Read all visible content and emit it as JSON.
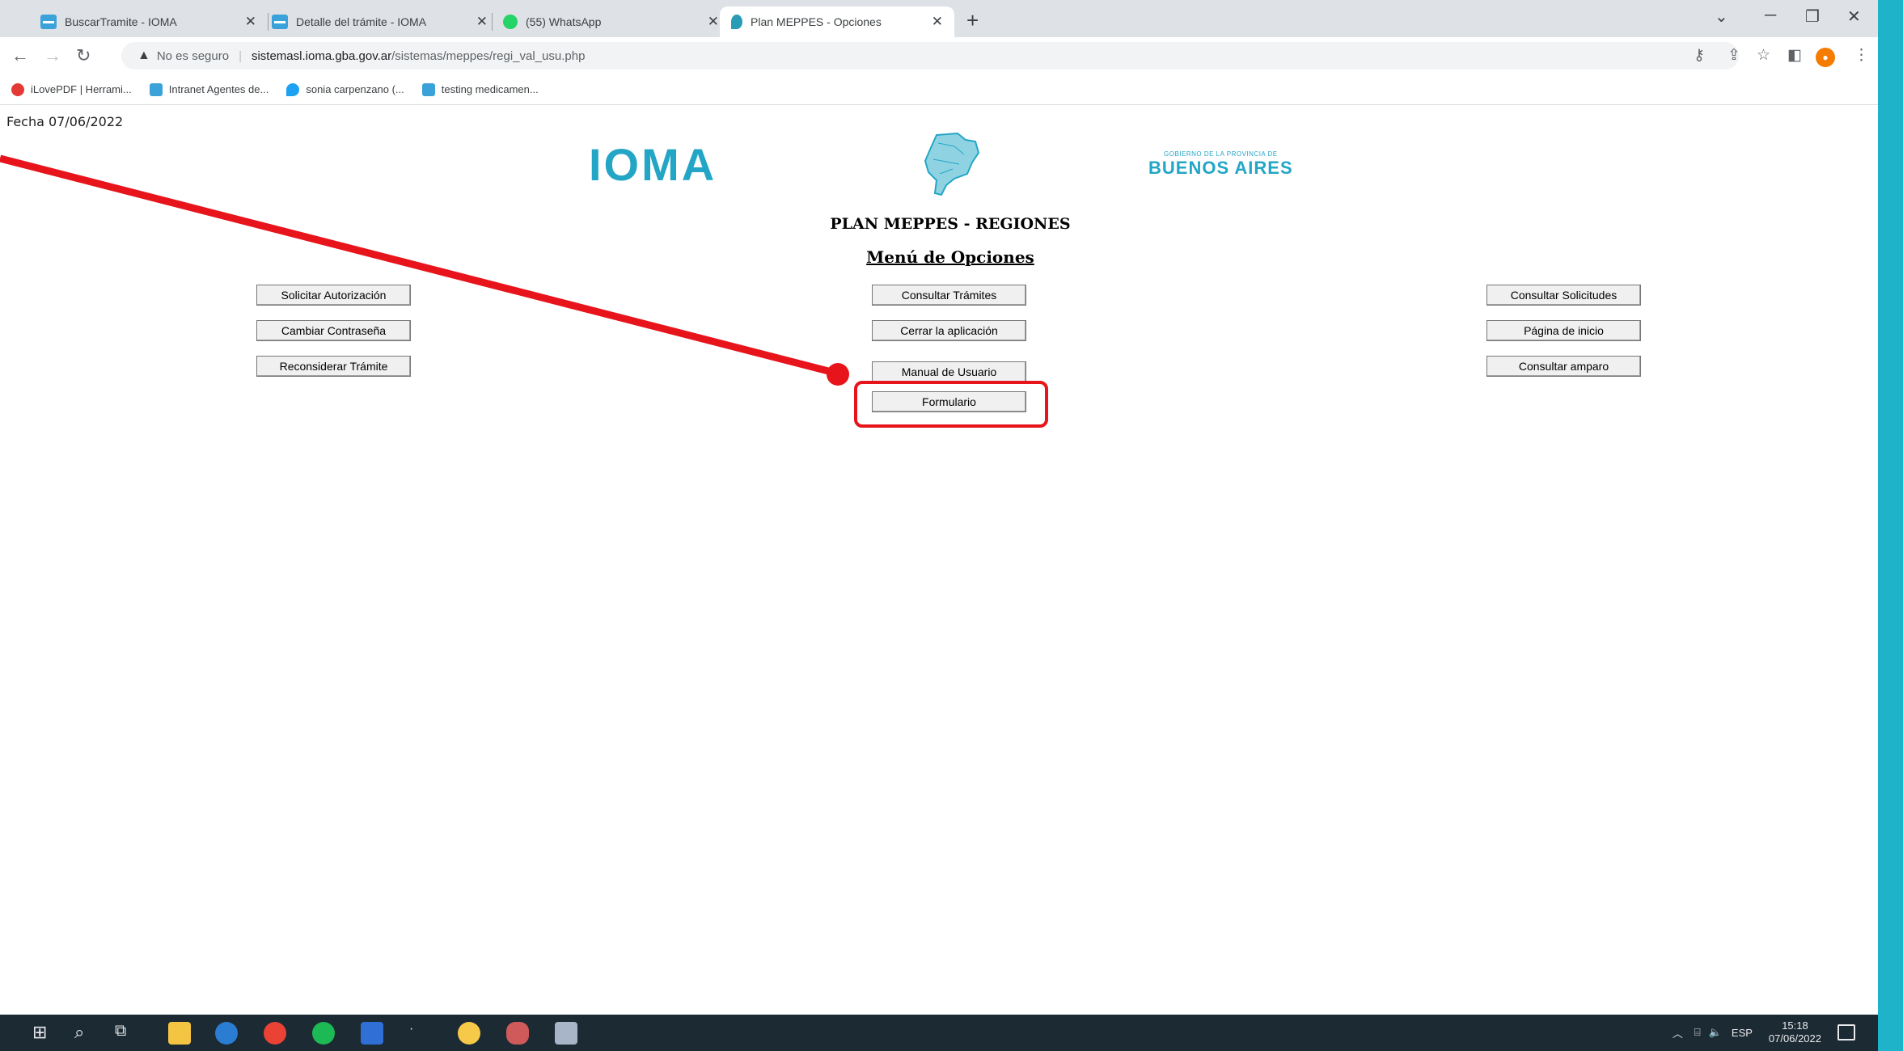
{
  "tabs": [
    {
      "title": "BuscarTramite - IOMA",
      "active": false
    },
    {
      "title": "Detalle del trámite - IOMA",
      "active": false
    },
    {
      "title": "(55) WhatsApp",
      "active": false
    },
    {
      "title": "Plan MEPPES - Opciones",
      "active": true
    }
  ],
  "address_bar": {
    "security": "No es seguro",
    "host": "sistemasl.ioma.gba.gov.ar",
    "path": "/sistemas/meppes/regi_val_usu.php"
  },
  "bookmarks": [
    {
      "label": "iLovePDF | Herrami...",
      "icon": "ilovepdf-icon"
    },
    {
      "label": "Intranet Agentes de...",
      "icon": "ioma-icon"
    },
    {
      "label": "sonia carpenzano (...",
      "icon": "twitter-icon"
    },
    {
      "label": "testing medicamen...",
      "icon": "ioma-icon"
    }
  ],
  "page": {
    "fecha": "Fecha 07/06/2022",
    "logo_text": "IOMA",
    "gob_small": "GOBIERNO DE LA PROVINCIA DE",
    "gob_big": "BUENOS AIRES",
    "plan_title": "PLAN MEPPES - REGIONES",
    "menu_title": "Menú de Opciones",
    "buttons": {
      "solicitar": "Solicitar Autorización",
      "cambiar": "Cambiar Contraseña",
      "reconsiderar": "Reconsiderar Trámite",
      "consultar_tramites": "Consultar Trámites",
      "cerrar": "Cerrar la aplicación",
      "manual": "Manual de Usuario",
      "formulario": "Formulario",
      "consultar_solicitudes": "Consultar Solicitudes",
      "pagina_inicio": "Página de inicio",
      "consultar_amparo": "Consultar amparo"
    }
  },
  "taskbar": {
    "lang": "ESP",
    "time": "15:18",
    "date": "07/06/2022"
  },
  "colors": {
    "annotation": "#e8141c",
    "brand": "#23a6c6",
    "frame": "#1fb3c9"
  }
}
